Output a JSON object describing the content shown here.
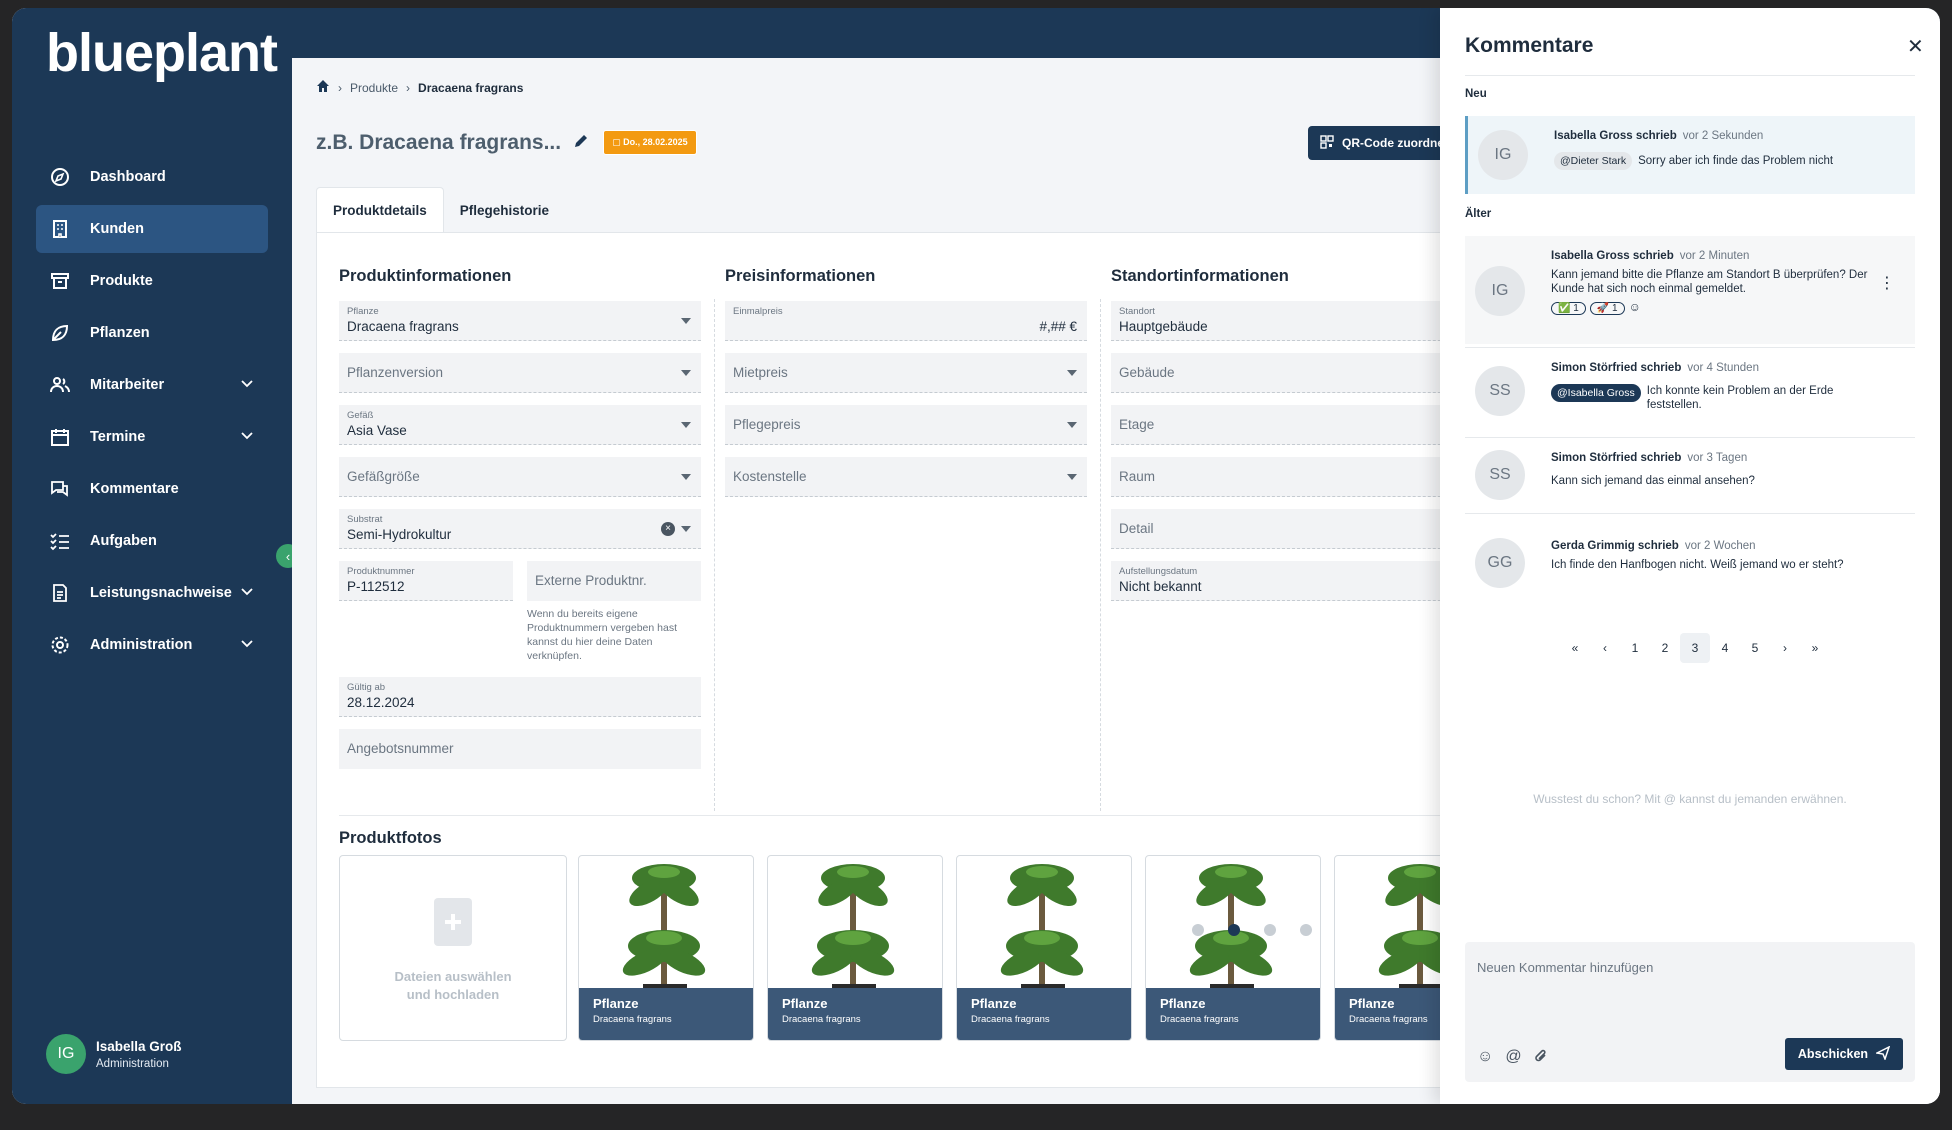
{
  "app": {
    "logo": "blueplant"
  },
  "sidebar": {
    "items": [
      {
        "label": "Dashboard",
        "icon": "compass-icon"
      },
      {
        "label": "Kunden",
        "icon": "building-icon"
      },
      {
        "label": "Produkte",
        "icon": "archive-icon"
      },
      {
        "label": "Pflanzen",
        "icon": "leaf-icon"
      },
      {
        "label": "Mitarbeiter",
        "icon": "users-icon"
      },
      {
        "label": "Termine",
        "icon": "calendar-icon"
      },
      {
        "label": "Kommentare",
        "icon": "chat-icon"
      },
      {
        "label": "Aufgaben",
        "icon": "checklist-icon"
      },
      {
        "label": "Leistungsnachweise",
        "icon": "document-icon"
      },
      {
        "label": "Administration",
        "icon": "gear-icon"
      }
    ],
    "active": "Kunden"
  },
  "user": {
    "initials": "IG",
    "name": "Isabella Groß",
    "role": "Administration"
  },
  "breadcrumb": {
    "items": [
      "Produkte",
      "Dracaena fragrans"
    ]
  },
  "page": {
    "title": "z.B. Dracaena fragrans...",
    "date_badge": "Do., 28.02.2025",
    "qr_button": "QR-Code zuordnen"
  },
  "tabs": [
    "Produktdetails",
    "Pflegehistorie"
  ],
  "product": {
    "title": "Produktinformationen",
    "pflanze": {
      "label": "Pflanze",
      "value": "Dracaena fragrans"
    },
    "pflanzenversion": {
      "placeholder": "Pflanzenversion"
    },
    "gefaess": {
      "label": "Gefäß",
      "value": "Asia Vase"
    },
    "gefaessgroesse": {
      "placeholder": "Gefäßgröße"
    },
    "substrat": {
      "label": "Substrat",
      "value": "Semi-Hydrokultur"
    },
    "produktnummer": {
      "label": "Produktnummer",
      "value": "P-112512"
    },
    "externe": {
      "placeholder": "Externe Produktnr."
    },
    "hint": "Wenn du bereits eigene Produktnummern vergeben hast kannst du hier deine Daten verknüpfen.",
    "gueltig": {
      "label": "Gültig ab",
      "value": "28.12.2024"
    },
    "angebotsnummer": {
      "placeholder": "Angebotsnummer"
    }
  },
  "price": {
    "title": "Preisinformationen",
    "einmalpreis": {
      "label": "Einmalpreis",
      "value": "#,## €"
    },
    "mietpreis": "Mietpreis",
    "pflegepreis": "Pflegepreis",
    "kostenstelle": "Kostenstelle"
  },
  "location": {
    "title": "Standortinformationen",
    "standort": {
      "label": "Standort",
      "value": "Hauptgebäude"
    },
    "gebaeude": "Gebäude",
    "etage": "Etage",
    "raum": "Raum",
    "detail": "Detail",
    "aufstellung": {
      "label": "Aufstellungsdatum",
      "value": "Nicht bekannt"
    }
  },
  "photos": {
    "title": "Produktfotos",
    "upload_line1": "Dateien auswählen",
    "upload_line2": "und hochladen",
    "items": [
      {
        "title": "Pflanze",
        "subtitle": "Dracaena fragrans"
      },
      {
        "title": "Pflanze",
        "subtitle": "Dracaena fragrans"
      },
      {
        "title": "Pflanze",
        "subtitle": "Dracaena fragrans"
      },
      {
        "title": "Pflanze",
        "subtitle": "Dracaena fragrans"
      },
      {
        "title": "Pflanze",
        "subtitle": "Dracaena fragrans"
      }
    ],
    "carousel_active": 2
  },
  "comments": {
    "title": "Kommentare",
    "new_label": "Neu",
    "older_label": "Älter",
    "new": [
      {
        "initials": "IG",
        "author": "Isabella Gross schrieb",
        "time": "vor 2 Sekunden",
        "mention": "@Dieter Stark",
        "text": "Sorry aber ich finde das Problem nicht"
      }
    ],
    "older": [
      {
        "initials": "IG",
        "author": "Isabella Gross schrieb",
        "time": "vor 2 Minuten",
        "text": "Kann jemand bitte die Pflanze am Standort B überprüfen? Der Kunde hat sich noch einmal gemeldet.",
        "reactions": [
          "✅ 1",
          "🚀 1"
        ]
      },
      {
        "initials": "SS",
        "author": "Simon Störfried schrieb",
        "time": "vor 4 Stunden",
        "mention": "@Isabella Gross",
        "text": "Ich konnte kein Problem an der Erde feststellen."
      },
      {
        "initials": "SS",
        "author": "Simon Störfried schrieb",
        "time": "vor 3 Tagen",
        "text": "Kann sich jemand das einmal ansehen?"
      },
      {
        "initials": "GG",
        "author": "Gerda Grimmig schrieb",
        "time": "vor 2 Wochen",
        "text": "Ich finde den Hanfbogen nicht. Weiß jemand wo er steht?"
      }
    ],
    "pagination": {
      "pages": [
        "1",
        "2",
        "3",
        "4",
        "5"
      ],
      "current": "3",
      "first": "«",
      "prev": "‹",
      "next": "›",
      "last": "»"
    },
    "tip": "Wusstest du schon? Mit @ kannst du jemanden erwähnen.",
    "compose_placeholder": "Neuen Kommentar hinzufügen",
    "send_label": "Abschicken"
  }
}
